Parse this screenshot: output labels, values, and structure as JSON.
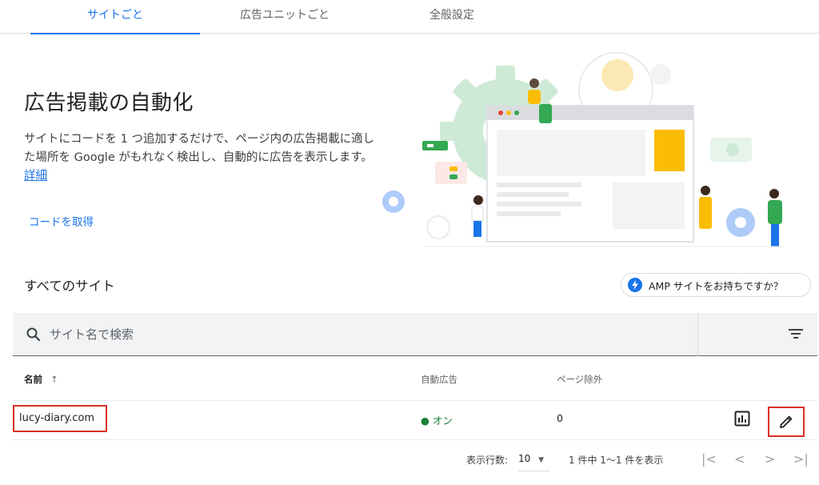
{
  "tabs": [
    {
      "label": "サイトごと"
    },
    {
      "label": "広告ユニットごと"
    },
    {
      "label": "全般設定"
    }
  ],
  "hero": {
    "title": "広告掲載の自動化",
    "description": "サイトにコードを 1 つ追加するだけで、ページ内の広告掲載に適した場所を Google がもれなく検出し、自動的に広告を表示します。",
    "details_link": "詳細",
    "get_code": "コードを取得"
  },
  "sites_section": {
    "title": "すべてのサイト",
    "amp_button": "AMP サイトをお持ちですか？"
  },
  "search": {
    "placeholder": "サイト名で検索"
  },
  "table": {
    "headers": {
      "name": "名前",
      "auto_ads": "自動広告",
      "page_exclusions": "ページ除外"
    },
    "rows": [
      {
        "name": "lucy-diary.com",
        "auto_ads": "オン",
        "page_exclusions": "0"
      }
    ]
  },
  "pagination": {
    "rows_label": "表示行数:",
    "rows_value": "10",
    "range_text": "1 件中 1〜1 件を表示"
  },
  "colors": {
    "accent": "#1a73e8",
    "status_on": "#188038",
    "highlight": "#d93025"
  }
}
